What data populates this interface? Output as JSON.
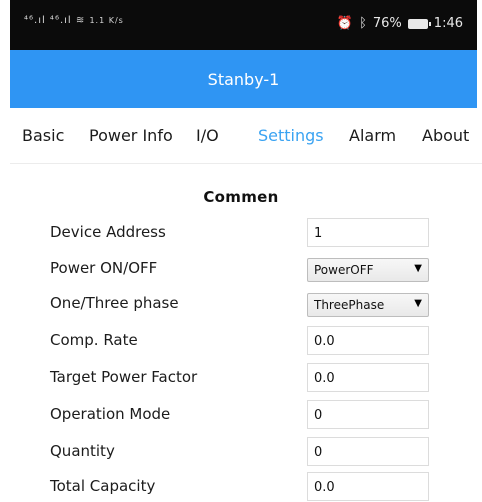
{
  "status_bar": {
    "signal_text": "⁴⁶.ıl ⁴⁶.ıl",
    "speed": "1.1 K/s",
    "battery": "76%",
    "time": "1:46"
  },
  "header": {
    "title": "Stanby-1"
  },
  "tabs": [
    {
      "label": "Basic",
      "active": false
    },
    {
      "label": "Power Info",
      "active": false
    },
    {
      "label": "I/O",
      "active": false
    },
    {
      "label": "Settings",
      "active": true
    },
    {
      "label": "Alarm",
      "active": false
    },
    {
      "label": "About",
      "active": false
    }
  ],
  "section": {
    "title": "Commen"
  },
  "rows": [
    {
      "label": "Device Address",
      "type": "input",
      "value": "1"
    },
    {
      "label": "Power ON/OFF",
      "type": "select",
      "value": "PowerOFF"
    },
    {
      "label": "One/Three phase",
      "type": "select",
      "value": "ThreePhase"
    },
    {
      "label": "Comp. Rate",
      "type": "input",
      "value": "0.0"
    },
    {
      "label": "Target Power Factor",
      "type": "input",
      "value": "0.0"
    },
    {
      "label": "Operation Mode",
      "type": "input",
      "value": "0"
    },
    {
      "label": "Quantity",
      "type": "input",
      "value": "0"
    },
    {
      "label": "Total Capacity",
      "type": "input",
      "value": "0.0"
    }
  ],
  "colors": {
    "accent": "#2f95f3",
    "active_tab": "#3aa3f2",
    "status_bar": "#0b0b0b"
  }
}
